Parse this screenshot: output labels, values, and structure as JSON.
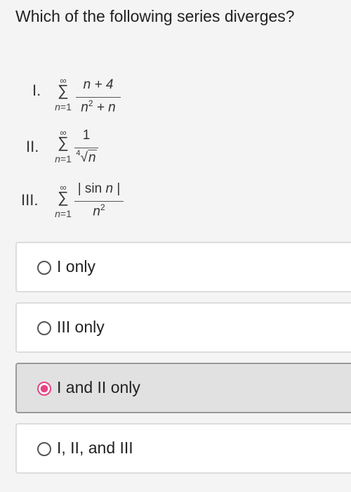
{
  "question": "Which of the following series diverges?",
  "series": [
    {
      "roman": "I.",
      "sigma_upper": "∞",
      "sigma_symbol": "∑",
      "sigma_lower_var": "n",
      "sigma_lower_rest": "=1",
      "numerator": "n + 4",
      "denominator_base": "n",
      "denominator_exp": "2",
      "denominator_rest": " + n"
    },
    {
      "roman": "II.",
      "sigma_upper": "∞",
      "sigma_symbol": "∑",
      "sigma_lower_var": "n",
      "sigma_lower_rest": "=1",
      "numerator": "1",
      "root_index": "4",
      "root_sign": "√",
      "root_body": "n"
    },
    {
      "roman": "III.",
      "sigma_upper": "∞",
      "sigma_symbol": "∑",
      "sigma_lower_var": "n",
      "sigma_lower_rest": "=1",
      "numerator_pre": "| sin ",
      "numerator_var": "n",
      "numerator_post": " |",
      "denominator_base": "n",
      "denominator_exp": "2"
    }
  ],
  "options": [
    {
      "label": "I only",
      "selected": false
    },
    {
      "label": "III only",
      "selected": false
    },
    {
      "label": "I and II only",
      "selected": true
    },
    {
      "label": "I, II, and III",
      "selected": false
    }
  ],
  "colors": {
    "selected_radio": "#e64384",
    "selected_background": "#e1e1e1"
  }
}
